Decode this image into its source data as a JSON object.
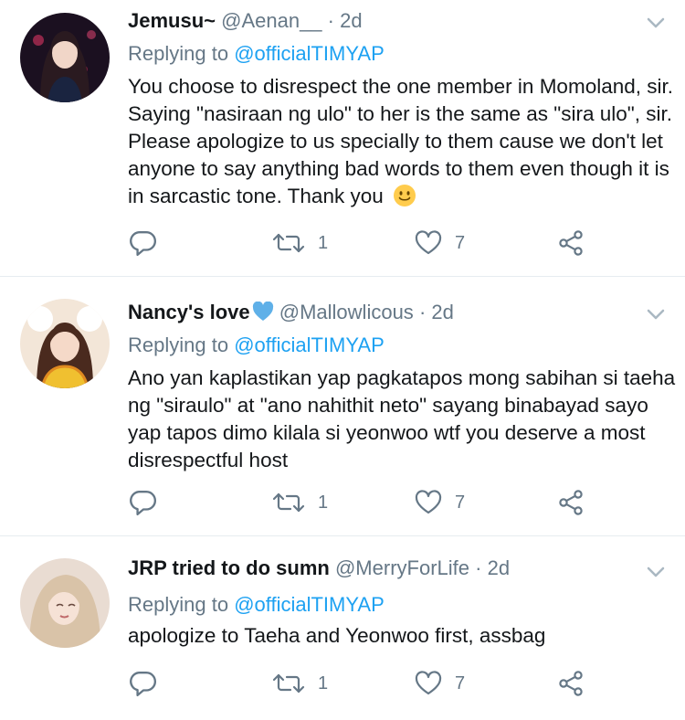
{
  "tweets": [
    {
      "name": "Jemusu~",
      "handle": "@Aenan__",
      "dot": "·",
      "time": "2d",
      "replying_prefix": "Replying to ",
      "replying_to": "@officialTIMYAP",
      "text": "You choose to disrespect the one member in Momoland, sir. Saying \"nasiraan ng ulo\" to her is the same as \"sira ulo\", sir. Please apologize to us specially to them cause we don't let anyone to say anything bad words to them even though it is in sarcastic tone. Thank you",
      "retweets": "1",
      "likes": "7"
    },
    {
      "name": "Nancy's love",
      "handle": "@Mallowlicous",
      "dot": "·",
      "time": "2d",
      "replying_prefix": "Replying to ",
      "replying_to": "@officialTIMYAP",
      "text": "Ano yan kaplastikan yap pagkatapos mong sabihan si taeha ng \"siraulo\" at \"ano nahithit neto\" sayang binabayad sayo yap tapos dimo kilala si yeonwoo wtf you deserve a most disrespectful host",
      "retweets": "1",
      "likes": "7"
    },
    {
      "name": "JRP tried to do sumn",
      "handle": "@MerryForLife",
      "dot": "·",
      "time": "2d",
      "replying_prefix": "Replying to ",
      "replying_to": "@officialTIMYAP",
      "text": "apologize to Taeha and Yeonwoo first, assbag",
      "retweets": "1",
      "likes": "7"
    }
  ],
  "colors": {
    "mention": "#1da1f2",
    "muted": "#657786",
    "heart_emoji": "#5fb0e8",
    "divider": "#e6ecf0"
  },
  "icons": [
    "reply-icon",
    "retweet-icon",
    "like-icon",
    "share-icon",
    "chevron-down-icon",
    "smiley-emoji",
    "blue-heart-emoji"
  ]
}
